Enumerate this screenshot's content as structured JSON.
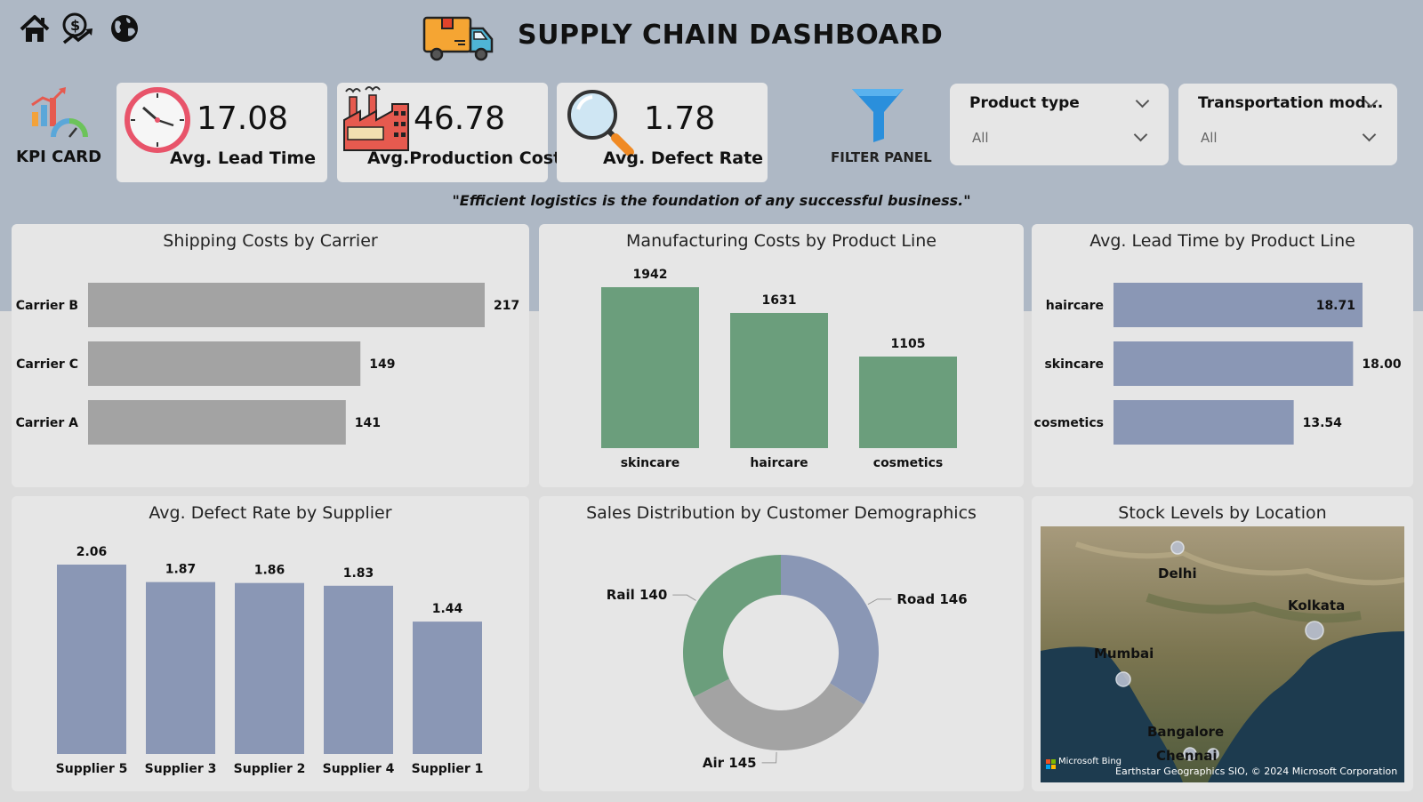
{
  "header": {
    "title": "SUPPLY CHAIN DASHBOARD",
    "nav_icons": [
      "home-icon",
      "dollar-trend-icon",
      "globe-icon"
    ]
  },
  "kpi_card_label": "KPI CARD",
  "kpis": [
    {
      "value": "17.08",
      "label": "Avg. Lead Time",
      "icon": "clock-icon"
    },
    {
      "value": "46.78",
      "label": "Avg.Production Cost",
      "icon": "factory-icon"
    },
    {
      "value": "1.78",
      "label": "Avg. Defect Rate",
      "icon": "magnifier-icon"
    }
  ],
  "filter_panel": {
    "label": "FILTER PANEL",
    "icon": "funnel-icon"
  },
  "slicers": [
    {
      "title": "Product type",
      "value": "All"
    },
    {
      "title": "Transportation mod...",
      "value": "All"
    }
  ],
  "quote": "\"Efficient logistics is the foundation of any successful business.\"",
  "colors": {
    "grey_bar": "#a3a3a3",
    "green_bar": "#6b9e7c",
    "blue_bar": "#8a97b5",
    "top_background": "#aeb8c5",
    "panel_background": "#e6e6e6"
  },
  "chart_data": [
    {
      "type": "bar",
      "orientation": "horizontal",
      "title": "Shipping Costs by Carrier",
      "categories": [
        "Carrier B",
        "Carrier C",
        "Carrier A"
      ],
      "values": [
        217,
        149,
        141
      ],
      "labels": [
        "217",
        "149",
        "141"
      ],
      "color": "#a3a3a3"
    },
    {
      "type": "bar",
      "orientation": "vertical",
      "title": "Manufacturing Costs by Product Line",
      "categories": [
        "skincare",
        "haircare",
        "cosmetics"
      ],
      "values": [
        1942,
        1631,
        1105
      ],
      "labels": [
        "1942",
        "1631",
        "1105"
      ],
      "color": "#6b9e7c"
    },
    {
      "type": "bar",
      "orientation": "horizontal",
      "title": "Avg. Lead Time by Product Line",
      "categories": [
        "haircare",
        "skincare",
        "cosmetics"
      ],
      "values": [
        18.71,
        18.0,
        13.54
      ],
      "labels": [
        "18.71",
        "18.00",
        "13.54"
      ],
      "color": "#8a97b5"
    },
    {
      "type": "bar",
      "orientation": "vertical",
      "title": "Avg. Defect Rate by Supplier",
      "categories": [
        "Supplier 5",
        "Supplier 3",
        "Supplier 2",
        "Supplier 4",
        "Supplier 1"
      ],
      "values": [
        2.06,
        1.87,
        1.86,
        1.83,
        1.44
      ],
      "labels": [
        "2.06",
        "1.87",
        "1.86",
        "1.83",
        "1.44"
      ],
      "color": "#8a97b5"
    },
    {
      "type": "pie",
      "donut": true,
      "title": "Sales Distribution by Customer Demographics",
      "categories": [
        "Road",
        "Air",
        "Rail"
      ],
      "values": [
        146,
        145,
        140
      ],
      "labels": [
        "Road 146",
        "Air 145",
        "Rail 140"
      ],
      "colors": [
        "#8a97b5",
        "#a3a3a3",
        "#6b9e7c"
      ]
    }
  ],
  "map": {
    "title": "Stock Levels by Location",
    "cities": [
      "Delhi",
      "Kolkata",
      "Mumbai",
      "Bangalore",
      "Chennai"
    ],
    "attribution_logo": "Microsoft Bing",
    "attribution_text": "Earthstar Geographics SIO, © 2024 Microsoft Corporation"
  }
}
